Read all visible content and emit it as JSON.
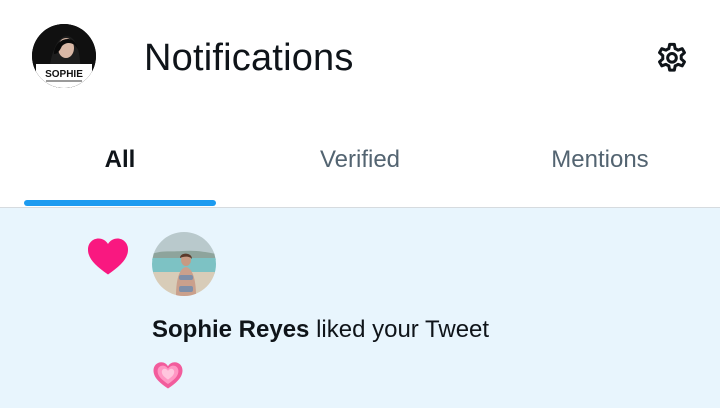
{
  "header": {
    "title": "Notifications",
    "avatar_icon": "profile-avatar",
    "avatar_caption": "SOPHIE",
    "settings_icon": "gear-icon"
  },
  "tabs": [
    {
      "label": "All",
      "active": true
    },
    {
      "label": "Verified",
      "active": false
    },
    {
      "label": "Mentions",
      "active": false
    }
  ],
  "notification": {
    "icon": "heart-icon",
    "user_name": "Sophie Reyes",
    "action_text": " liked your Tweet",
    "tweet_content_icon": "pink-heart-emoji"
  },
  "colors": {
    "accent": "#1d9bf0",
    "heart": "#f91880",
    "notification_bg": "#e8f5fd",
    "text_primary": "#0f1419",
    "text_secondary": "#536471"
  }
}
